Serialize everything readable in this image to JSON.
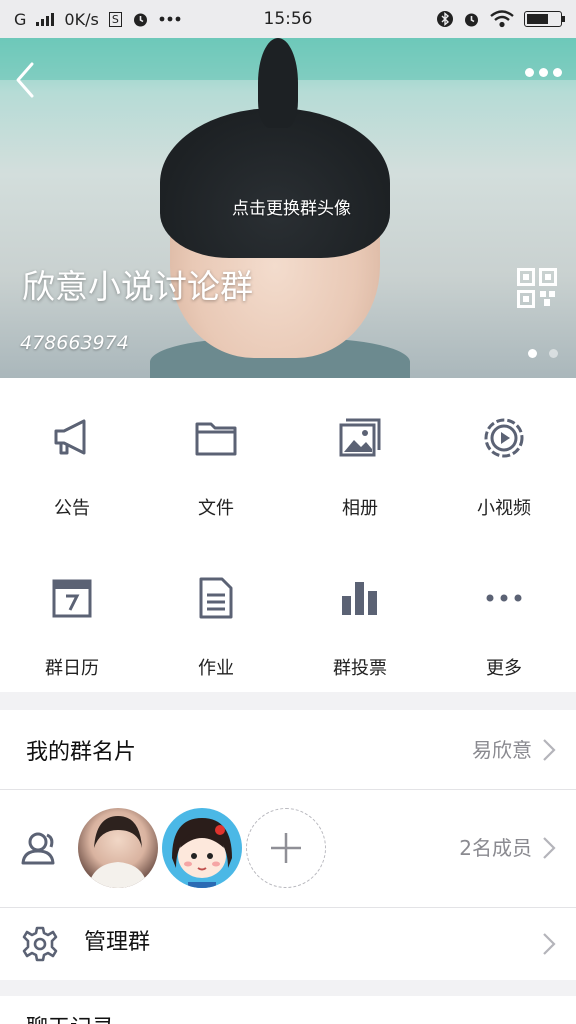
{
  "status_bar": {
    "carrier": "G",
    "speed": "0K/s",
    "sim_icon": "S",
    "time": "15:56",
    "battery_percent": 70,
    "icons": [
      "signal-icon",
      "sim-icon",
      "alarm-icon",
      "more-dots-icon",
      "bluetooth-icon",
      "alarm-icon",
      "wifi-icon",
      "battery-icon"
    ]
  },
  "header": {
    "change_avatar_label": "点击更换群头像",
    "group_name": "欣意小说讨论群",
    "group_id": "478663974",
    "active_page": 1,
    "page_count": 2
  },
  "features": [
    {
      "label": "公告",
      "icon": "megaphone-icon"
    },
    {
      "label": "文件",
      "icon": "folder-icon"
    },
    {
      "label": "相册",
      "icon": "photo-album-icon"
    },
    {
      "label": "小视频",
      "icon": "video-icon"
    },
    {
      "label": "群日历",
      "icon": "calendar-icon"
    },
    {
      "label": "作业",
      "icon": "homework-document-icon"
    },
    {
      "label": "群投票",
      "icon": "vote-chart-icon"
    },
    {
      "label": "更多",
      "icon": "more-dots-icon"
    }
  ],
  "my_card": {
    "label": "我的群名片",
    "value": "易欣意"
  },
  "members": {
    "count_label": "2名成员"
  },
  "manage": {
    "label": "管理群"
  },
  "chat_history": {
    "label": "聊天记录"
  },
  "colors": {
    "icon": "#5b6274",
    "divider": "#e3e3e6",
    "value": "#8a8a90",
    "background": "#f2f2f4"
  }
}
